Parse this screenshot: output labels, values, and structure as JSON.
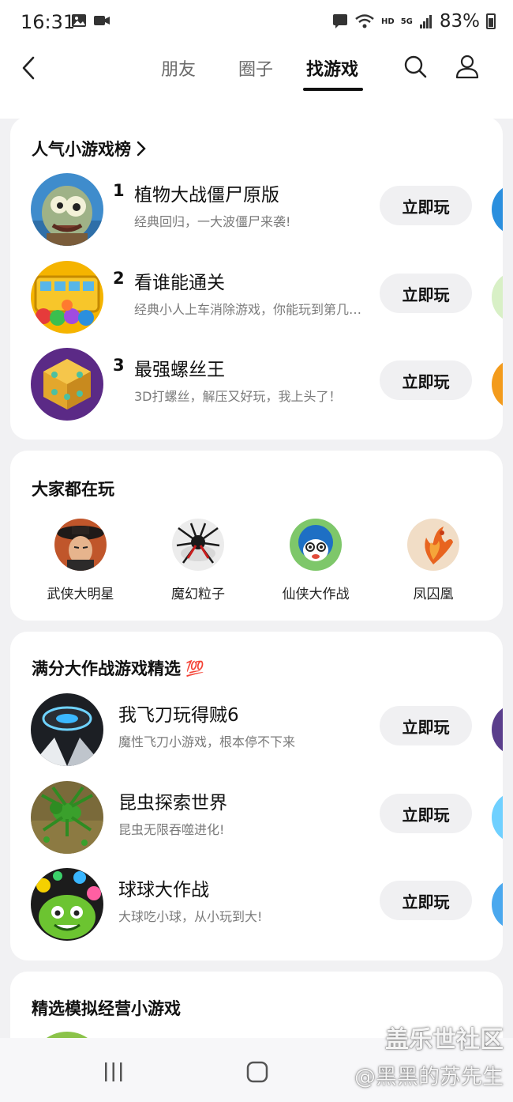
{
  "status_bar": {
    "time": "16:31",
    "network": "HD",
    "network_type": "5G",
    "battery": "83%"
  },
  "nav": {
    "tabs": [
      "朋友",
      "圈子",
      "找游戏"
    ],
    "active_tab": "找游戏"
  },
  "ranking": {
    "title": "人气小游戏榜",
    "play_label": "立即玩",
    "items": [
      {
        "rank": "1",
        "name": "植物大战僵尸原版",
        "desc": "经典回归，一大波僵尸来袭!"
      },
      {
        "rank": "2",
        "name": "看谁能通关",
        "desc": "经典小人上车消除游戏，你能玩到第几关？"
      },
      {
        "rank": "3",
        "name": "最强螺丝王",
        "desc": "3D打螺丝，解压又好玩，我上头了！"
      }
    ]
  },
  "popular": {
    "title": "大家都在玩",
    "items": [
      {
        "label": "武侠大明星"
      },
      {
        "label": "魔幻粒子"
      },
      {
        "label": "仙侠大作战"
      },
      {
        "label": "凤囚凰"
      }
    ]
  },
  "selection": {
    "title": "满分大作战游戏精选",
    "badge": "💯",
    "play_label": "立即玩",
    "items": [
      {
        "name": "我飞刀玩得贼6",
        "desc": "魔性飞刀小游戏，根本停不下来"
      },
      {
        "name": "昆虫探索世界",
        "desc": "昆虫无限吞噬进化!"
      },
      {
        "name": "球球大作战",
        "desc": "大球吃小球，从小玩到大!"
      }
    ]
  },
  "simulation": {
    "title": "精选模拟经营小游戏"
  },
  "watermark": {
    "line1": "盖乐世社区",
    "line2": "@黑黑的苏先生"
  },
  "icons": {
    "back": "chevron-left-icon",
    "search": "search-icon",
    "profile": "user-icon",
    "more": "chevron-right-icon"
  }
}
